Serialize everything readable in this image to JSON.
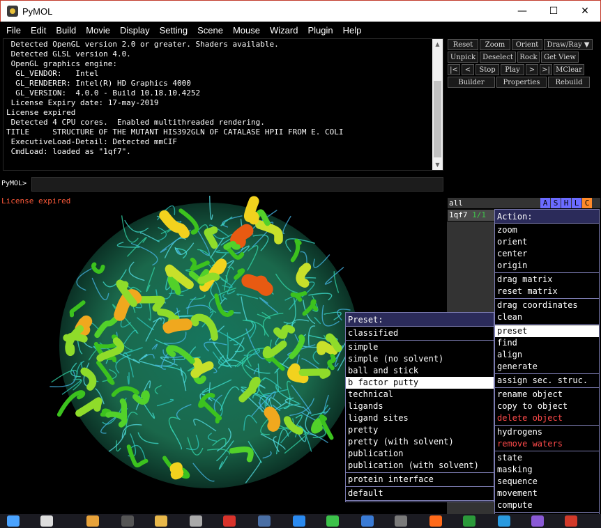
{
  "window": {
    "title": "PyMOL",
    "minimize_glyph": "—",
    "maximize_glyph": "☐",
    "close_glyph": "✕"
  },
  "menubar": [
    "File",
    "Edit",
    "Build",
    "Movie",
    "Display",
    "Setting",
    "Scene",
    "Mouse",
    "Wizard",
    "Plugin",
    "Help"
  ],
  "console": {
    "lines": [
      " Detected OpenGL version 2.0 or greater. Shaders available.",
      " Detected GLSL version 4.0.",
      " OpenGL graphics engine:",
      "  GL_VENDOR:   Intel",
      "  GL_RENDERER: Intel(R) HD Graphics 4000",
      "  GL_VERSION:  4.0.0 - Build 10.18.10.4252",
      " License Expiry date: 17-may-2019",
      "License expired",
      " Detected 4 CPU cores.  Enabled multithreaded rendering.",
      "TITLE     STRUCTURE OF THE MUTANT HIS392GLN OF CATALASE HPII FROM E. COLI",
      " ExecutiveLoad-Detail: Detected mmCIF",
      " CmdLoad: loaded as \"1qf7\"."
    ],
    "prompt": "PyMOL>",
    "command_value": ""
  },
  "buttons": {
    "row1": [
      "Reset",
      "Zoom",
      "Orient",
      "Draw/Ray ▼"
    ],
    "row2": [
      "Unpick",
      "Deselect",
      "Rock",
      "Get View"
    ],
    "row3": [
      "|<",
      "<",
      "Stop",
      "Play",
      ">",
      ">|",
      "MClear"
    ],
    "row4": [
      "Builder",
      "Properties",
      "Rebuild"
    ]
  },
  "viewer": {
    "status": "License expired"
  },
  "objects": {
    "all_label": "all",
    "toggles": [
      "A",
      "S",
      "H",
      "L",
      "C"
    ],
    "toggle_colors": [
      "#6b6bff",
      "#6b6bff",
      "#6b6bff",
      "#6b6bff",
      "#ff8a2a"
    ],
    "object_name": "1qf7",
    "object_frames": "1/1"
  },
  "action_menu": {
    "header": "Action:",
    "groups": [
      [
        "zoom",
        "orient",
        "center",
        "origin"
      ],
      [
        "drag matrix",
        "reset matrix"
      ],
      [
        "drag coordinates",
        "clean"
      ],
      [
        "preset",
        "find",
        "align",
        "generate"
      ],
      [
        "assign sec. struc."
      ],
      [
        "rename object",
        "copy to object",
        "delete object"
      ],
      [
        "hydrogens",
        "remove waters"
      ],
      [
        "state",
        "masking",
        "sequence",
        "movement",
        "compute"
      ]
    ],
    "selected": "preset",
    "red_items": [
      "delete object",
      "remove waters"
    ]
  },
  "preset_menu": {
    "header": "Preset:",
    "groups": [
      [
        "classified"
      ],
      [
        "simple",
        "simple (no solvent)",
        "ball and stick",
        "b factor putty",
        "technical",
        "ligands",
        "ligand sites",
        "pretty",
        "pretty (with solvent)",
        "publication",
        "publication (with solvent)"
      ],
      [
        "protein interface"
      ],
      [
        "default"
      ]
    ],
    "selected": "b factor putty"
  },
  "colors": {
    "menu_border": "#7b7bb0",
    "menu_header": "#2b2b5a",
    "warning_red": "#ff4a4a",
    "license_orange": "#ff5a3a"
  },
  "taskbar": {
    "icons": [
      "windows-start-icon",
      "task-view-icon",
      "paint-icon",
      "terminal-icon",
      "folder-icon",
      "database-icon",
      "youdao-icon",
      "pymol-icon",
      "app-star-icon",
      "wechat-icon",
      "chrome-like-icon",
      "molecule-icon",
      "firefox-icon",
      "vim-icon",
      "telegram-icon",
      "visual-studio-icon",
      "app-red-icon"
    ]
  }
}
